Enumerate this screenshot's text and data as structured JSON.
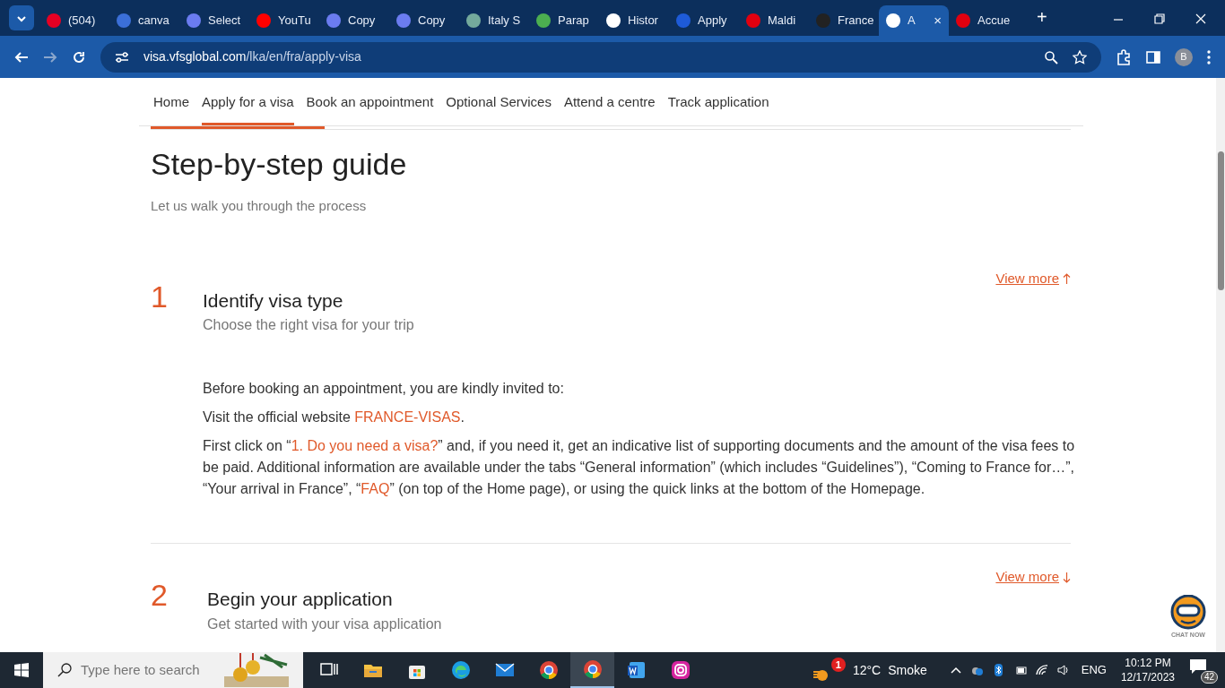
{
  "browser": {
    "tabs": [
      {
        "label": "(504)",
        "color": "#e60023",
        "selected": false
      },
      {
        "label": "canva",
        "color": "#3b6fd8",
        "selected": false
      },
      {
        "label": "Select",
        "color": "#6b7cf0",
        "selected": false
      },
      {
        "label": "YouTu",
        "color": "#ff0000",
        "selected": false
      },
      {
        "label": "Copy",
        "color": "#6b7cf0",
        "selected": false
      },
      {
        "label": "Copy",
        "color": "#6b7cf0",
        "selected": false
      },
      {
        "label": "Italy S",
        "color": "#74aa9c",
        "selected": false
      },
      {
        "label": "Parap",
        "color": "#4caf50",
        "selected": false
      },
      {
        "label": "Histor",
        "color": "#ffffff",
        "selected": false
      },
      {
        "label": "Apply",
        "color": "#1e5bd8",
        "selected": false
      },
      {
        "label": "Maldi",
        "color": "#e1000f",
        "selected": false
      },
      {
        "label": "France",
        "color": "#222222",
        "selected": false
      },
      {
        "label": "A",
        "color": "#ffffff",
        "selected": true
      },
      {
        "label": "Accue",
        "color": "#e1000f",
        "selected": false
      }
    ],
    "new_tab": "+",
    "close_tab": "×",
    "url_host": "visa.vfsglobal.com",
    "url_path": "/lka/en/fra/apply-visa",
    "profile": "B"
  },
  "site_nav": [
    {
      "label": "Home",
      "selected": false
    },
    {
      "label": "Apply for a visa",
      "selected": true
    },
    {
      "label": "Book an appointment",
      "selected": false
    },
    {
      "label": "Optional Services",
      "selected": false
    },
    {
      "label": "Attend a centre",
      "selected": false
    },
    {
      "label": "Track application",
      "selected": false
    }
  ],
  "guide": {
    "title": "Step-by-step guide",
    "subtitle": "Let us walk you through the process"
  },
  "steps": [
    {
      "number": "1",
      "title": "Identify visa type",
      "subtitle": "Choose the right visa for your trip",
      "view_more": "View more",
      "expanded": true,
      "paragraphs": [
        [
          {
            "text": "Before booking an appointment, you are kindly invited to:",
            "link": false
          }
        ],
        [
          {
            "text": "Visit the official website ",
            "link": false
          },
          {
            "text": "FRANCE-VISAS",
            "link": true
          },
          {
            "text": ".",
            "link": false
          }
        ],
        [
          {
            "text": "First click on “",
            "link": false
          },
          {
            "text": "1. Do you need a visa?",
            "link": true
          },
          {
            "text": "” and, if you need it, get an indicative list of supporting documents and the amount of the visa fees to be paid. Additional information are available under the tabs “General information” (which includes “Guidelines”), “Coming to France for…”, “Your arrival in France”, “",
            "link": false
          },
          {
            "text": "FAQ",
            "link": true
          },
          {
            "text": "” (on top of the Home page), or using the quick links at the bottom of the Homepage.",
            "link": false
          }
        ]
      ]
    },
    {
      "number": "2",
      "title": "Begin your application",
      "subtitle": "Get started with your visa application",
      "view_more": "View more",
      "expanded": false
    }
  ],
  "chat": {
    "label": "CHAT NOW"
  },
  "taskbar": {
    "search_placeholder": "Type here to search",
    "apps": [
      {
        "kind": "taskview",
        "selected": false
      },
      {
        "kind": "folder",
        "selected": false
      },
      {
        "kind": "store",
        "selected": false
      },
      {
        "kind": "edge",
        "selected": false
      },
      {
        "kind": "mail",
        "selected": false
      },
      {
        "kind": "chrome",
        "selected": false
      },
      {
        "kind": "chrome",
        "selected": true
      },
      {
        "kind": "word",
        "selected": false
      },
      {
        "kind": "instagram",
        "selected": false
      }
    ],
    "weather_badge": "1",
    "temperature": "12°C",
    "weather": "Smoke",
    "language": "ENG",
    "time": "10:12 PM",
    "date": "12/17/2023",
    "notifications": "42"
  }
}
